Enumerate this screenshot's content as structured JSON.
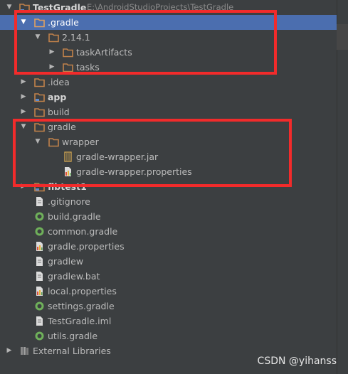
{
  "tree": {
    "root": {
      "name": "TestGradle",
      "path": "E:\\AndroidStudioProjects\\TestGradle"
    },
    "items": [
      {
        "label": ".gradle"
      },
      {
        "label": "2.14.1"
      },
      {
        "label": "taskArtifacts"
      },
      {
        "label": "tasks"
      },
      {
        "label": ".idea"
      },
      {
        "label": "app"
      },
      {
        "label": "build"
      },
      {
        "label": "gradle"
      },
      {
        "label": "wrapper"
      },
      {
        "label": "gradle-wrapper.jar"
      },
      {
        "label": "gradle-wrapper.properties"
      },
      {
        "label": "fibtest1"
      },
      {
        "label": ".gitignore"
      },
      {
        "label": "build.gradle"
      },
      {
        "label": "common.gradle"
      },
      {
        "label": "gradle.properties"
      },
      {
        "label": "gradlew"
      },
      {
        "label": "gradlew.bat"
      },
      {
        "label": "local.properties"
      },
      {
        "label": "settings.gradle"
      },
      {
        "label": "TestGradle.iml"
      },
      {
        "label": "utils.gradle"
      },
      {
        "label": "External Libraries"
      }
    ]
  },
  "watermark": "CSDN @yihanss",
  "colors": {
    "selection": "#4b6eaf",
    "annotation_box": "#f22b2b",
    "folder": "#c0814a",
    "gradle_icon": "#6fb05a"
  },
  "icons": {
    "folder": "folder-icon",
    "module": "module-folder-icon",
    "jar": "jar-file-icon",
    "properties": "properties-file-icon",
    "gradle": "gradle-file-icon",
    "text": "text-file-icon",
    "library": "library-icon"
  }
}
